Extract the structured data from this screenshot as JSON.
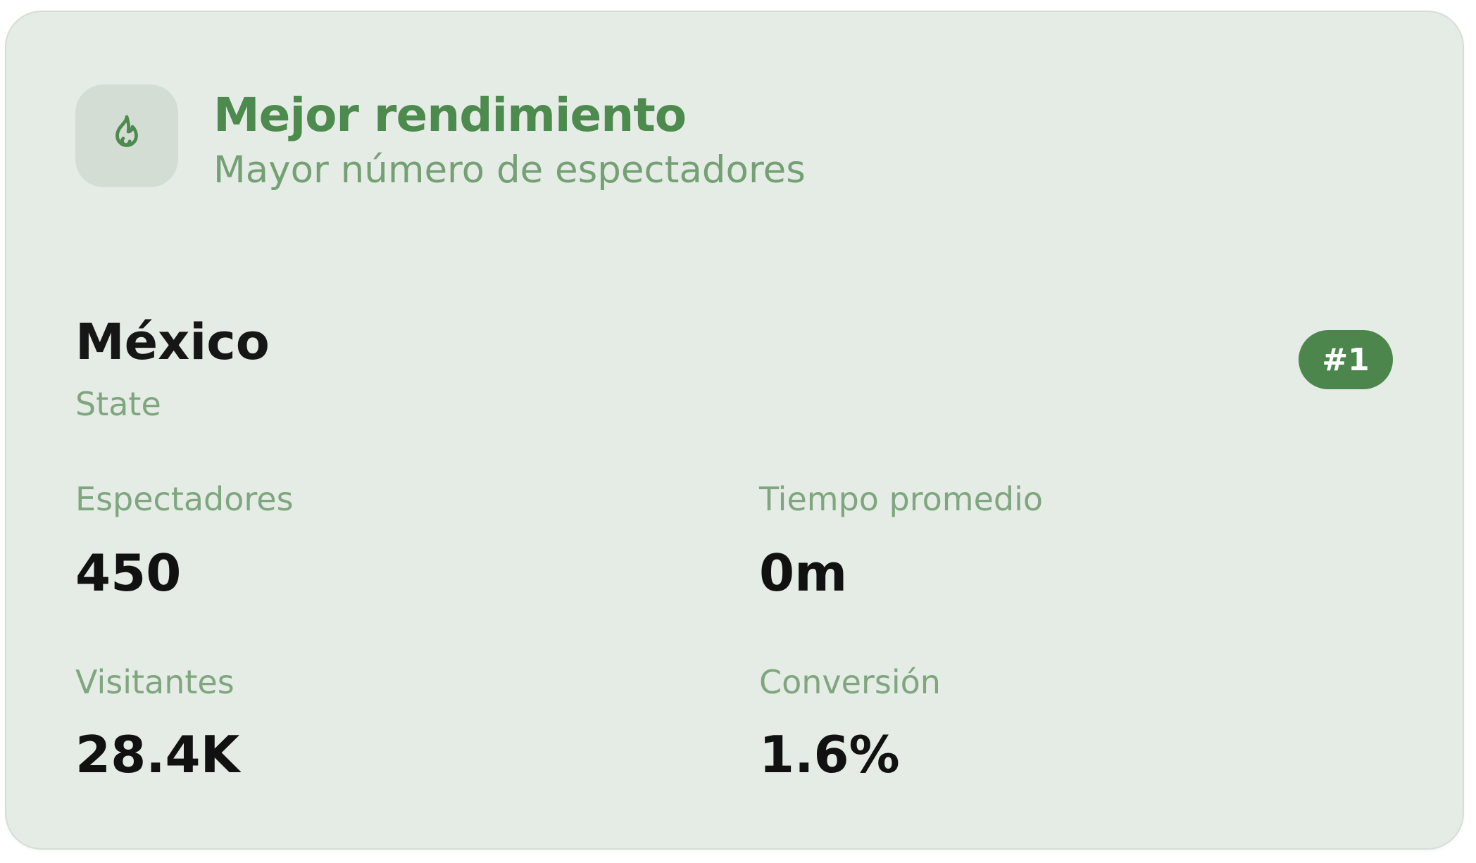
{
  "card": {
    "title": "Mejor rendimiento",
    "subtitle": "Mayor número de espectadores",
    "icon": "flame-icon",
    "accent_color": "#4d8a4d",
    "background_color": "#e5ece6"
  },
  "region": {
    "name": "México",
    "type": "State",
    "rank": "#1"
  },
  "metrics": [
    {
      "label": "Espectadores",
      "value": "450"
    },
    {
      "label": "Tiempo promedio",
      "value": "0m"
    },
    {
      "label": "Visitantes",
      "value": "28.4K"
    },
    {
      "label": "Conversión",
      "value": "1.6%"
    }
  ]
}
